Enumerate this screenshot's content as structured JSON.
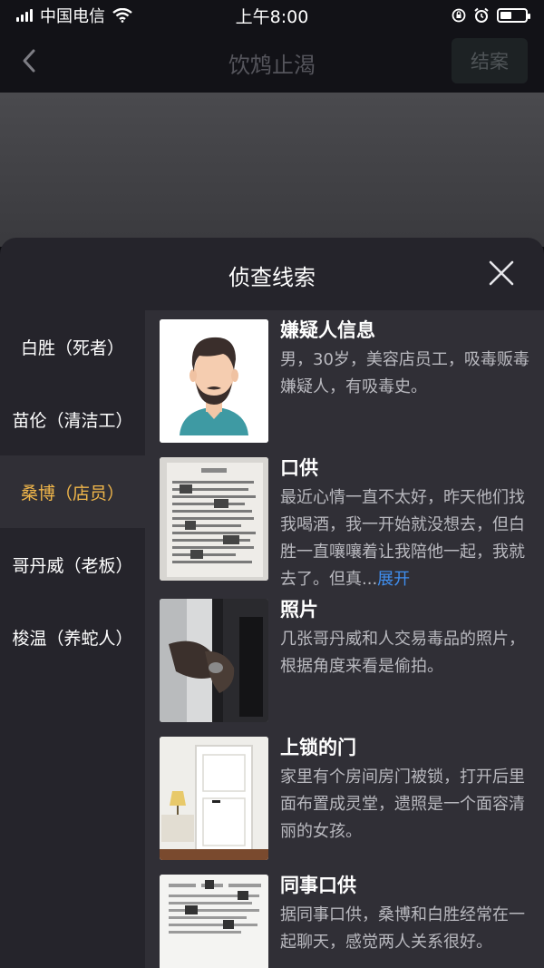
{
  "status_bar": {
    "carrier": "中国电信",
    "time": "上午8:00"
  },
  "nav": {
    "title": "饮鸩止渴",
    "close_case_label": "结案",
    "back_icon": "chevron-left-icon"
  },
  "sheet": {
    "title": "侦查线索",
    "close_icon": "close-icon"
  },
  "characters": [
    {
      "label": "白胜（死者）",
      "active": false
    },
    {
      "label": "苗伦（清洁工）",
      "active": false
    },
    {
      "label": "桑博（店员）",
      "active": true
    },
    {
      "label": "哥丹威（老板）",
      "active": false
    },
    {
      "label": "梭温（养蛇人）",
      "active": false
    }
  ],
  "clues": [
    {
      "title": "嫌疑人信息",
      "desc": "男，30岁，美容店员工，吸毒贩毒嫌疑人，有吸毒史。",
      "image": "suspect-avatar"
    },
    {
      "title": "口供",
      "desc": "最近心情一直不太好，昨天他们找我喝酒，我一开始就没想去，但白胜一直嚷嚷着让我陪他一起，我就去了。但真...",
      "expand": "展开",
      "image": "testimony-document"
    },
    {
      "title": "照片",
      "desc": "几张哥丹威和人交易毒品的照片，根据角度来看是偷拍。",
      "image": "drug-deal-photo"
    },
    {
      "title": "上锁的门",
      "desc": "家里有个房间房门被锁，打开后里面布置成灵堂，遗照是一个面容清丽的女孩。",
      "image": "locked-door-photo"
    },
    {
      "title": "同事口供",
      "desc": "据同事口供，桑博和白胜经常在一起聊天，感觉两人关系很好。",
      "image": "coworker-testimony-document"
    }
  ],
  "colors": {
    "active_tab": "#f0b64a",
    "expand_link": "#3f8ff0"
  }
}
